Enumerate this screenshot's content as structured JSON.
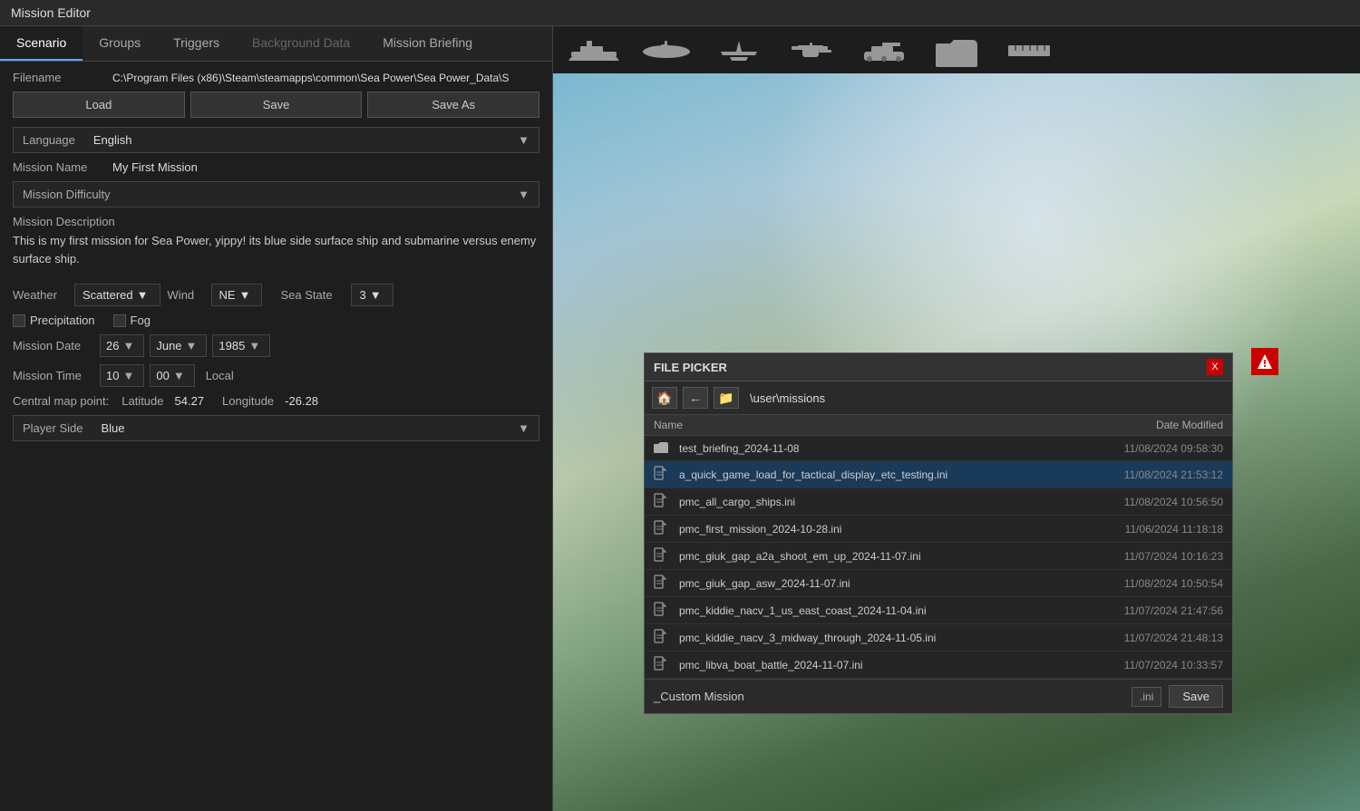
{
  "title_bar": {
    "title": "Mission Editor"
  },
  "tabs": [
    {
      "label": "Scenario",
      "active": true
    },
    {
      "label": "Groups",
      "active": false
    },
    {
      "label": "Triggers",
      "active": false
    },
    {
      "label": "Background Data",
      "active": false,
      "dim": true
    },
    {
      "label": "Mission Briefing",
      "active": false
    }
  ],
  "left_panel": {
    "filename_label": "Filename",
    "filename_value": "C:\\Program Files (x86)\\Steam\\steamapps\\common\\Sea Power\\Sea Power_Data\\S",
    "load_btn": "Load",
    "save_btn": "Save",
    "save_as_btn": "Save As",
    "language_label": "Language",
    "language_value": "English",
    "mission_name_label": "Mission Name",
    "mission_name_value": "My First Mission",
    "mission_difficulty_label": "Mission Difficulty",
    "mission_description_label": "Mission Description",
    "mission_description_text": "This is my first mission for Sea Power, yippy! its blue side surface ship and submarine versus enemy surface ship.",
    "weather_label": "Weather",
    "weather_value": "Scattered",
    "wind_label": "Wind",
    "wind_value": "NE",
    "sea_state_label": "Sea State",
    "sea_state_value": "3",
    "precipitation_label": "Precipitation",
    "fog_label": "Fog",
    "mission_date_label": "Mission Date",
    "date_day": "26",
    "date_month": "June",
    "date_year": "1985",
    "mission_time_label": "Mission Time",
    "time_hour": "10",
    "time_minute": "00",
    "time_local": "Local",
    "map_point_label": "Central map point:",
    "latitude_label": "Latitude",
    "latitude_value": "54.27",
    "longitude_label": "Longitude",
    "longitude_value": "-26.28",
    "player_side_label": "Player Side",
    "player_side_value": "Blue"
  },
  "file_picker": {
    "title": "FILE PICKER",
    "close_btn": "X",
    "path": "\\user\\missions",
    "col_name": "Name",
    "col_date": "Date Modified",
    "items": [
      {
        "type": "folder",
        "name": "test_briefing_2024-11-08",
        "date": "11/08/2024 09:58:30"
      },
      {
        "type": "file",
        "name": "a_quick_game_load_for_tactical_display_etc_testing.ini",
        "date": "11/08/2024 21:53:12",
        "selected": true
      },
      {
        "type": "file",
        "name": "pmc_all_cargo_ships.ini",
        "date": "11/08/2024 10:56:50"
      },
      {
        "type": "file",
        "name": "pmc_first_mission_2024-10-28.ini",
        "date": "11/06/2024 11:18:18"
      },
      {
        "type": "file",
        "name": "pmc_giuk_gap_a2a_shoot_em_up_2024-11-07.ini",
        "date": "11/07/2024 10:16:23"
      },
      {
        "type": "file",
        "name": "pmc_giuk_gap_asw_2024-11-07.ini",
        "date": "11/08/2024 10:50:54"
      },
      {
        "type": "file",
        "name": "pmc_kiddie_nacv_1_us_east_coast_2024-11-04.ini",
        "date": "11/07/2024 21:47:56"
      },
      {
        "type": "file",
        "name": "pmc_kiddie_nacv_3_midway_through_2024-11-05.ini",
        "date": "11/07/2024 21:48:13"
      },
      {
        "type": "file",
        "name": "pmc_libva_boat_battle_2024-11-07.ini",
        "date": "11/07/2024 10:33:57"
      }
    ],
    "custom_mission": "_Custom Mission",
    "ext_filter": ".ini",
    "save_btn": "Save"
  },
  "toolbar": {
    "icons": [
      "warship-icon",
      "submarine-icon",
      "aircraft-icon",
      "helicopter-icon",
      "tank-icon",
      "folder-icon",
      "ruler-icon"
    ]
  }
}
